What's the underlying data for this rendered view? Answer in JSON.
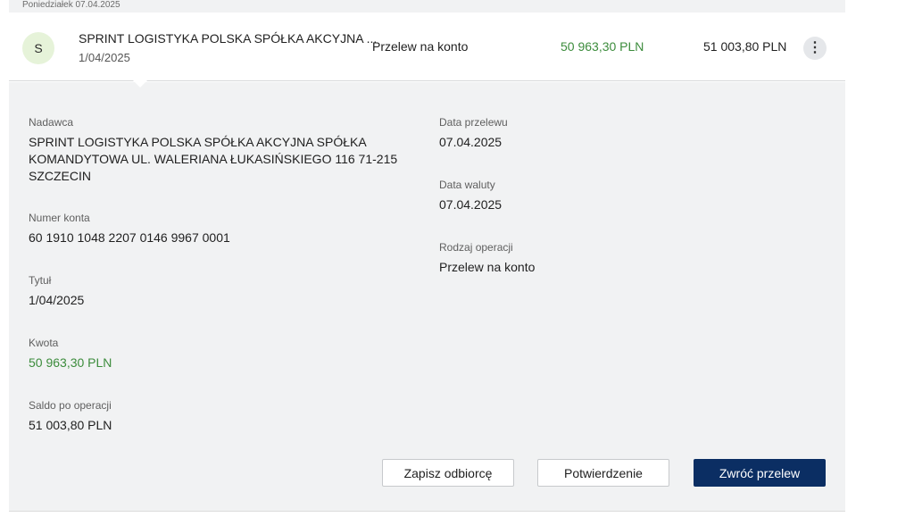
{
  "date_header": "Poniedziałek 07.04.2025",
  "transaction": {
    "avatar_letter": "S",
    "name": "SPRINT LOGISTYKA POLSKA SPÓŁKA AKCYJNA ...",
    "title": "1/04/2025",
    "type": "Przelew na konto",
    "amount": "50 963,30 PLN",
    "balance": "51 003,80 PLN",
    "more_icon": "⋮"
  },
  "details": {
    "sender_label": "Nadawca",
    "sender_line1": "SPRINT LOGISTYKA POLSKA SPÓŁKA AKCYJNA SPÓŁKA",
    "sender_line2": "KOMANDYTOWA UL. WALERIANA ŁUKASIŃSKIEGO 116 71-215",
    "sender_line3": "SZCZECIN",
    "account_label": "Numer konta",
    "account_value": "60 1910 1048 2207 0146 9967 0001",
    "title_label": "Tytuł",
    "title_value": "1/04/2025",
    "amount_label": "Kwota",
    "amount_value": "50 963,30 PLN",
    "balance_label": "Saldo po operacji",
    "balance_value": "51 003,80 PLN",
    "transfer_date_label": "Data przelewu",
    "transfer_date_value": "07.04.2025",
    "currency_date_label": "Data waluty",
    "currency_date_value": "07.04.2025",
    "operation_type_label": "Rodzaj operacji",
    "operation_type_value": "Przelew na konto"
  },
  "actions": {
    "save_recipient": "Zapisz odbiorcę",
    "confirmation": "Potwierdzenie",
    "return_transfer": "Zwróć przelew"
  },
  "colors": {
    "amount_green": "#3c8c3c",
    "primary_button": "#0b2e63",
    "avatar_bg": "#e6f3d9"
  }
}
